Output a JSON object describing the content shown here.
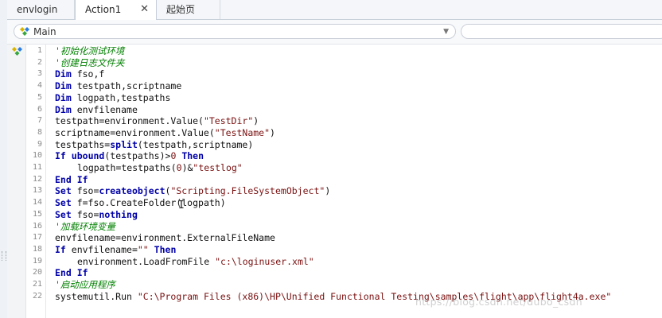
{
  "tabs": [
    {
      "label": "envlogin"
    },
    {
      "label": "Action1",
      "close": "✕"
    },
    {
      "label": "起始页"
    }
  ],
  "combo": {
    "main_label": "Main",
    "arrow": "▼"
  },
  "code_lines": [
    {
      "num": "1",
      "parts": [
        {
          "t": "'初始化测试环境",
          "c": "cm"
        }
      ],
      "indent": 0
    },
    {
      "num": "2",
      "parts": [
        {
          "t": "'创建日志文件夹",
          "c": "cm"
        }
      ],
      "indent": 0
    },
    {
      "num": "3",
      "parts": [
        {
          "t": "Dim",
          "c": "kw"
        },
        {
          "t": " fso,f",
          "c": ""
        }
      ],
      "indent": 0
    },
    {
      "num": "4",
      "parts": [
        {
          "t": "Dim",
          "c": "kw"
        },
        {
          "t": " testpath,scriptname",
          "c": ""
        }
      ],
      "indent": 0
    },
    {
      "num": "5",
      "parts": [
        {
          "t": "Dim",
          "c": "kw"
        },
        {
          "t": " logpath,testpaths",
          "c": ""
        }
      ],
      "indent": 0
    },
    {
      "num": "6",
      "parts": [
        {
          "t": "Dim",
          "c": "kw"
        },
        {
          "t": " envfilename",
          "c": ""
        }
      ],
      "indent": 0
    },
    {
      "num": "7",
      "parts": [
        {
          "t": "testpath=environment.Value(",
          "c": ""
        },
        {
          "t": "\"TestDir\"",
          "c": "str"
        },
        {
          "t": ")",
          "c": ""
        }
      ],
      "indent": 0
    },
    {
      "num": "8",
      "parts": [
        {
          "t": "scriptname=environment.Value(",
          "c": ""
        },
        {
          "t": "\"TestName\"",
          "c": "str"
        },
        {
          "t": ")",
          "c": ""
        }
      ],
      "indent": 0
    },
    {
      "num": "9",
      "parts": [
        {
          "t": "testpaths=",
          "c": ""
        },
        {
          "t": "split",
          "c": "fn"
        },
        {
          "t": "(testpath,scriptname)",
          "c": ""
        }
      ],
      "indent": 0
    },
    {
      "num": "10",
      "parts": [
        {
          "t": "If",
          "c": "kw"
        },
        {
          "t": " ",
          "c": ""
        },
        {
          "t": "ubound",
          "c": "fn"
        },
        {
          "t": "(testpaths)>",
          "c": ""
        },
        {
          "t": "0",
          "c": "num"
        },
        {
          "t": " ",
          "c": ""
        },
        {
          "t": "Then",
          "c": "kw"
        }
      ],
      "indent": 0
    },
    {
      "num": "11",
      "parts": [
        {
          "t": "logpath=testpaths(",
          "c": ""
        },
        {
          "t": "0",
          "c": "num"
        },
        {
          "t": ")&",
          "c": ""
        },
        {
          "t": "\"testlog\"",
          "c": "str"
        }
      ],
      "indent": 1
    },
    {
      "num": "12",
      "parts": [
        {
          "t": "End If",
          "c": "kw"
        }
      ],
      "indent": 0
    },
    {
      "num": "13",
      "parts": [
        {
          "t": "Set",
          "c": "kw"
        },
        {
          "t": " fso=",
          "c": ""
        },
        {
          "t": "createobject",
          "c": "fn"
        },
        {
          "t": "(",
          "c": ""
        },
        {
          "t": "\"Scripting.FileSystemObject\"",
          "c": "str"
        },
        {
          "t": ")",
          "c": ""
        }
      ],
      "indent": 0
    },
    {
      "num": "14",
      "parts": [
        {
          "t": "Set",
          "c": "kw"
        },
        {
          "t": " f=fso.CreateFolder(logpath)",
          "c": ""
        }
      ],
      "indent": 0
    },
    {
      "num": "15",
      "parts": [
        {
          "t": "Set",
          "c": "kw"
        },
        {
          "t": " fso=",
          "c": ""
        },
        {
          "t": "nothing",
          "c": "kw"
        }
      ],
      "indent": 0
    },
    {
      "num": "16",
      "parts": [
        {
          "t": "'加载环境变量",
          "c": "cm"
        }
      ],
      "indent": 0
    },
    {
      "num": "17",
      "parts": [
        {
          "t": "envfilename=environment.ExternalFileName",
          "c": ""
        }
      ],
      "indent": 0
    },
    {
      "num": "18",
      "parts": [
        {
          "t": "If",
          "c": "kw"
        },
        {
          "t": " envfilename=",
          "c": ""
        },
        {
          "t": "\"\"",
          "c": "str"
        },
        {
          "t": " ",
          "c": ""
        },
        {
          "t": "Then",
          "c": "kw"
        }
      ],
      "indent": 0
    },
    {
      "num": "19",
      "parts": [
        {
          "t": "environment.LoadFromFile ",
          "c": ""
        },
        {
          "t": "\"c:\\loginuser.xml\"",
          "c": "str"
        }
      ],
      "indent": 1
    },
    {
      "num": "20",
      "parts": [
        {
          "t": "End If",
          "c": "kw"
        }
      ],
      "indent": 0
    },
    {
      "num": "21",
      "parts": [
        {
          "t": "'启动应用程序",
          "c": "cm"
        }
      ],
      "indent": 0
    },
    {
      "num": "22",
      "parts": [
        {
          "t": "systemutil.Run ",
          "c": ""
        },
        {
          "t": "\"C:\\Program Files (x86)\\HP\\Unified Functional Testing\\samples\\flight\\app\\flight4a.exe\"",
          "c": "str"
        }
      ],
      "indent": 0
    }
  ],
  "watermark": "https://blog.csdn.net/dubo_csdn",
  "icons": {
    "breakpoint": "diamond-icon",
    "combo": "action-icon",
    "close": "close-icon",
    "dropdown": "chevron-down-icon"
  },
  "colors": {
    "keyword": "#0000a8",
    "string": "#7a1010",
    "comment": "#008000"
  }
}
